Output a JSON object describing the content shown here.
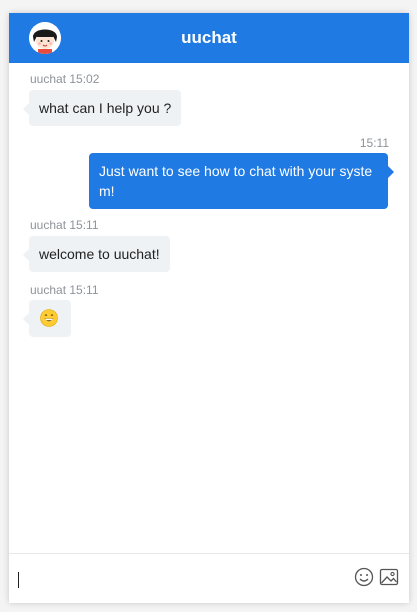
{
  "header": {
    "title": "uuchat",
    "avatar_icon": "user-avatar-icon"
  },
  "messages": [
    {
      "from": "uuchat",
      "meta": "uuchat 15:02",
      "text": "what can I help you ?"
    },
    {
      "from": "me",
      "meta": "15:11",
      "text": "Just want to see how to chat with your system!"
    },
    {
      "from": "uuchat",
      "meta": "uuchat 15:11",
      "text": "welcome to uuchat!"
    },
    {
      "from": "uuchat",
      "meta": "uuchat 15:11",
      "text": "😁"
    }
  ],
  "composer": {
    "value": "",
    "emoji_icon": "smiley-icon",
    "image_icon": "image-upload-icon"
  },
  "colors": {
    "accent": "#1f7ae3",
    "bubble_left": "#eff2f5",
    "meta": "#8e9399"
  }
}
